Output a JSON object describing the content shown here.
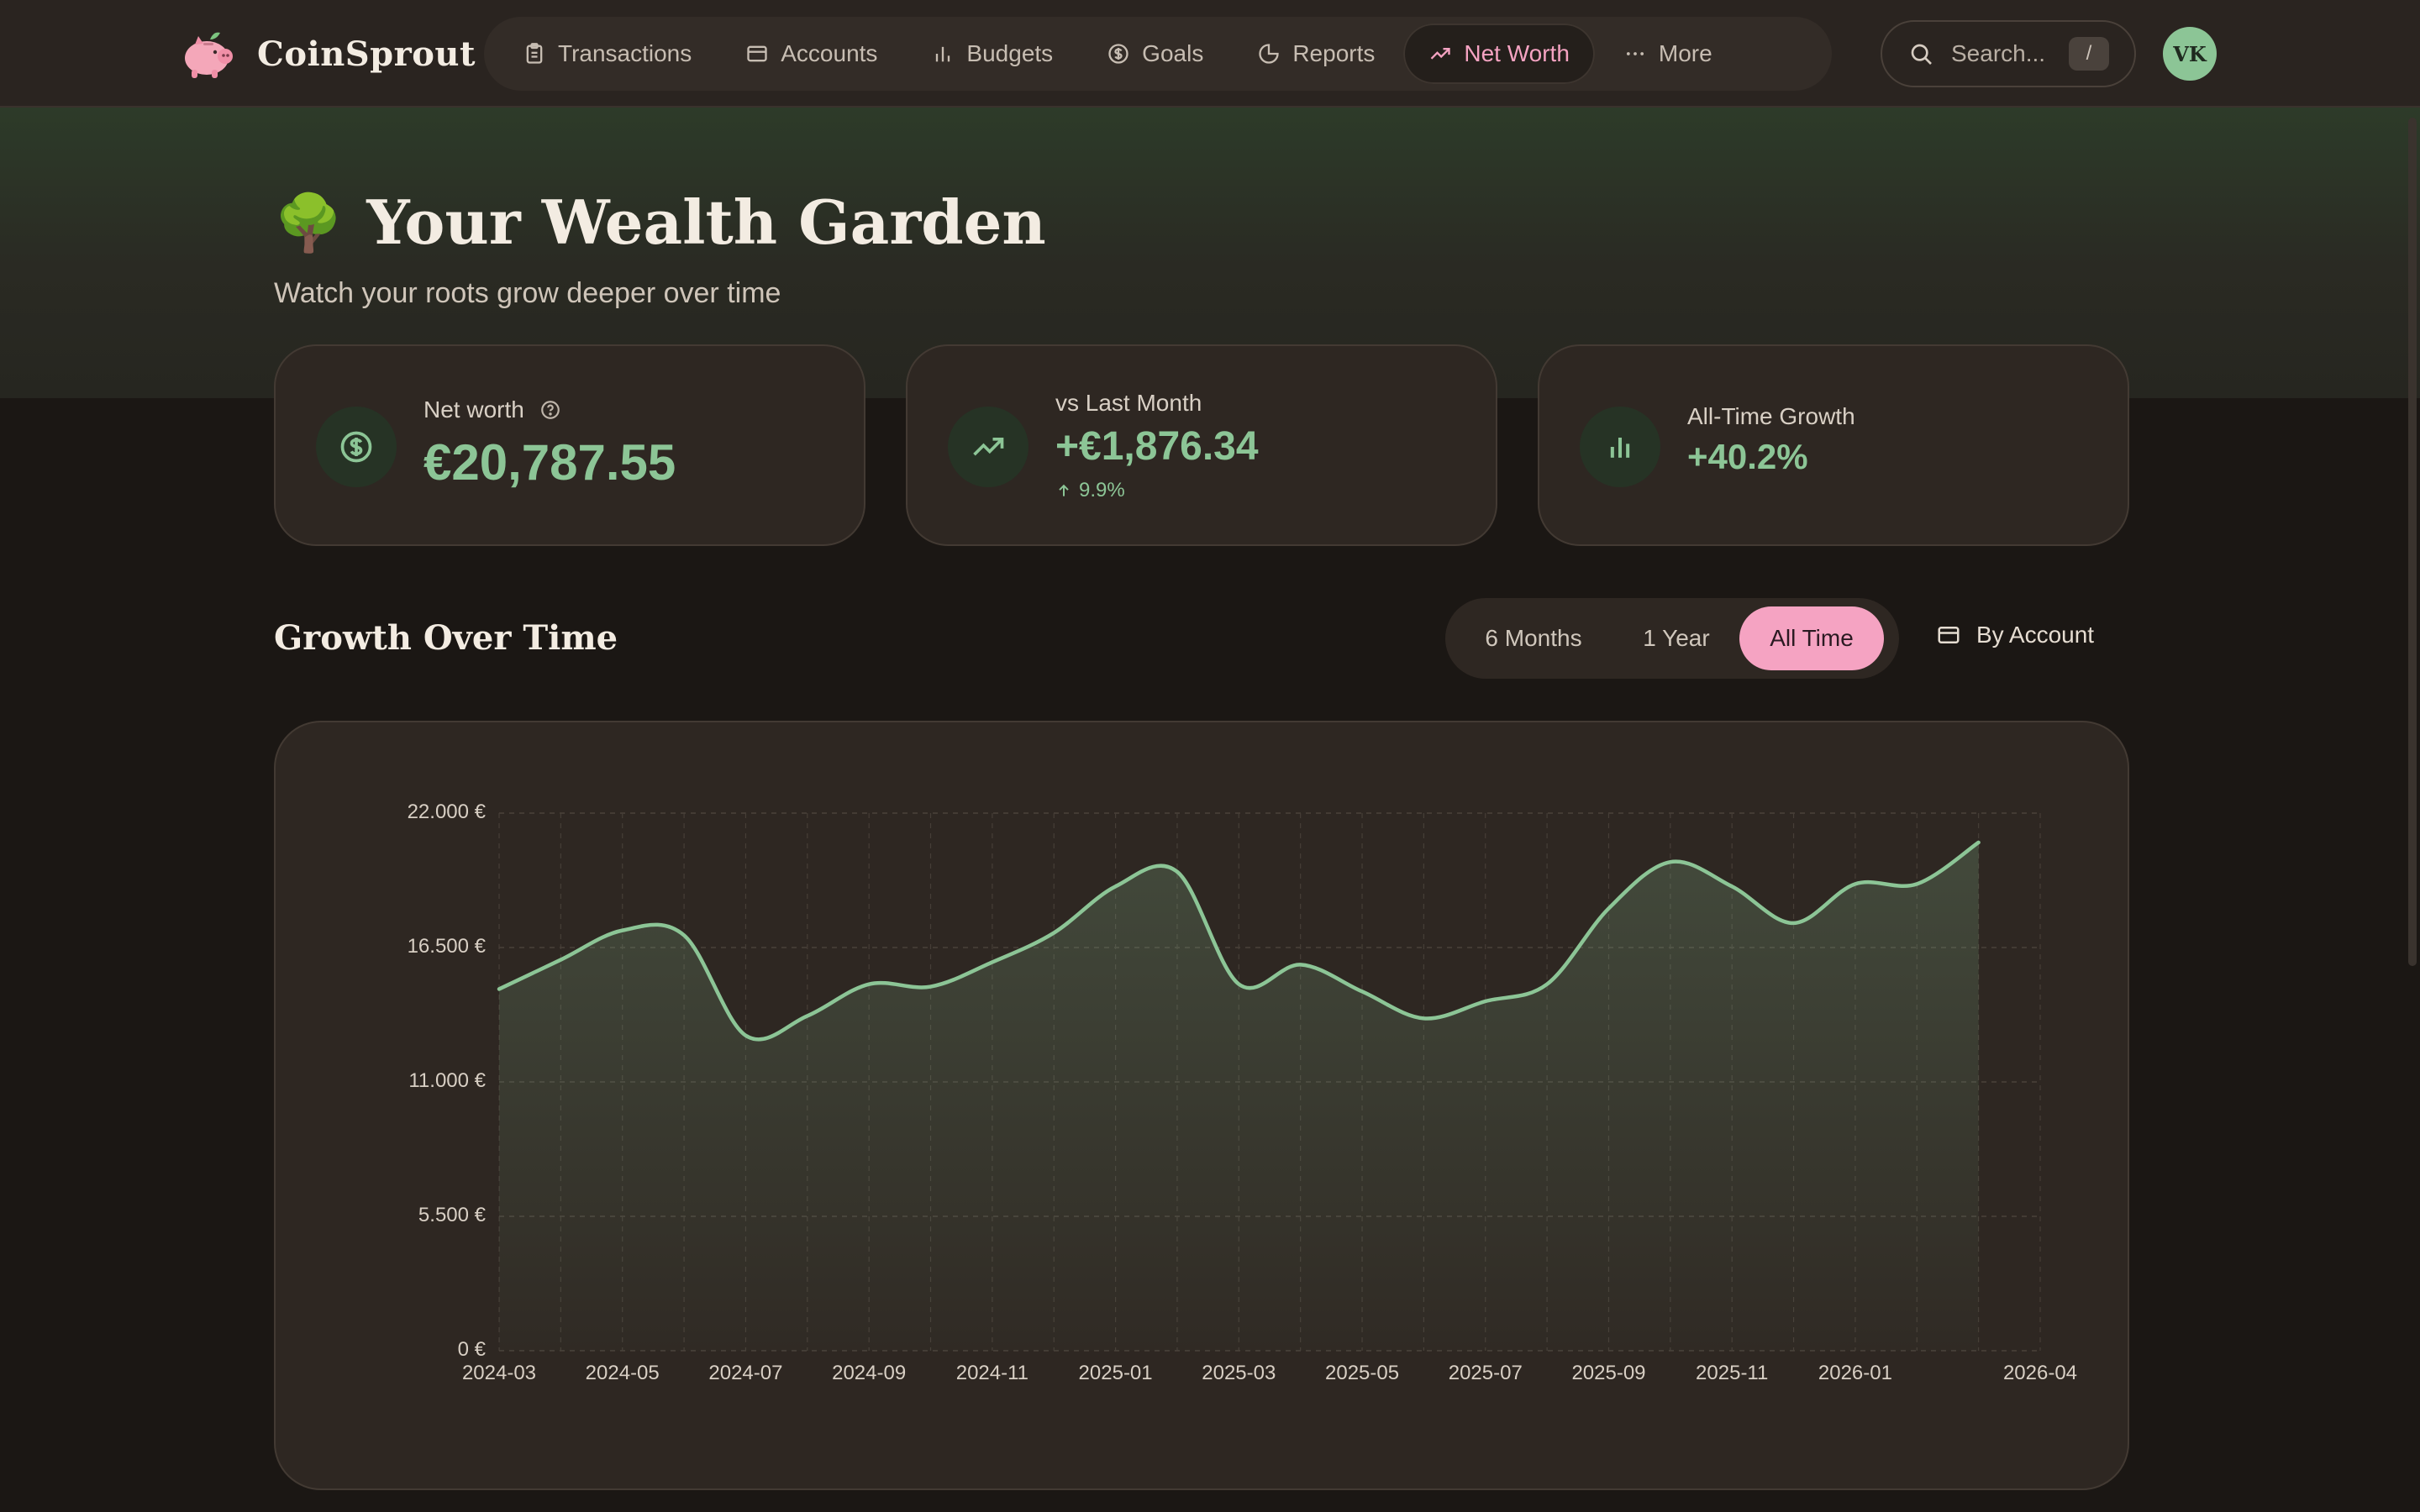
{
  "brand": {
    "name": "CoinSprout"
  },
  "nav": {
    "items": [
      {
        "label": "Transactions",
        "icon": "clipboard-icon"
      },
      {
        "label": "Accounts",
        "icon": "card-icon"
      },
      {
        "label": "Budgets",
        "icon": "bars-icon"
      },
      {
        "label": "Goals",
        "icon": "dollar-circle-icon"
      },
      {
        "label": "Reports",
        "icon": "pie-icon"
      },
      {
        "label": "Net Worth",
        "icon": "trend-up-icon",
        "active": true
      },
      {
        "label": "More",
        "icon": "ellipsis-icon"
      }
    ]
  },
  "search": {
    "placeholder": "Search...",
    "shortcut": "/"
  },
  "user": {
    "initials": "VK"
  },
  "hero": {
    "emoji": "🌳",
    "title": "Your Wealth Garden",
    "subtitle": "Watch your roots grow deeper over time"
  },
  "stats": {
    "net_worth": {
      "label": "Net worth",
      "value": "€20,787.55"
    },
    "vs_last_month": {
      "label": "vs Last Month",
      "value": "+€1,876.34",
      "delta": "9.9%"
    },
    "all_time": {
      "label": "All-Time Growth",
      "value": "+40.2%"
    }
  },
  "growth": {
    "title": "Growth Over Time",
    "ranges": [
      "6 Months",
      "1 Year",
      "All Time"
    ],
    "active_range": "All Time",
    "by_account": "By Account"
  },
  "colors": {
    "accent_green": "#8cc596",
    "accent_pink": "#f5a3c2",
    "card_bg": "#2e2722"
  },
  "chart_data": {
    "type": "area",
    "x": [
      "2024-03",
      "2024-04",
      "2024-05",
      "2024-06",
      "2024-07",
      "2024-08",
      "2024-09",
      "2024-10",
      "2024-11",
      "2024-12",
      "2025-01",
      "2025-02",
      "2025-03",
      "2025-04",
      "2025-05",
      "2025-06",
      "2025-07",
      "2025-08",
      "2025-09",
      "2025-10",
      "2025-11",
      "2025-12",
      "2026-01",
      "2026-02",
      "2026-03",
      "2026-04"
    ],
    "values": [
      14800,
      16000,
      17200,
      17000,
      12900,
      13700,
      15000,
      14900,
      15900,
      17100,
      19000,
      19600,
      15000,
      15800,
      14700,
      13600,
      14300,
      15000,
      18100,
      20000,
      19000,
      17500,
      19100,
      19100,
      20800
    ],
    "x_tick_labels": [
      "2024-03",
      "2024-05",
      "2024-07",
      "2024-09",
      "2024-11",
      "2025-01",
      "2025-03",
      "2025-05",
      "2025-07",
      "2025-09",
      "2025-11",
      "2026-01",
      "2026-04"
    ],
    "y_ticks": [
      0,
      5500,
      11000,
      16500,
      22000
    ],
    "y_tick_labels": [
      "0 €",
      "5.500 €",
      "11.000 €",
      "16.500 €",
      "22.000 €"
    ],
    "ylim": [
      0,
      22000
    ],
    "grid": true
  }
}
